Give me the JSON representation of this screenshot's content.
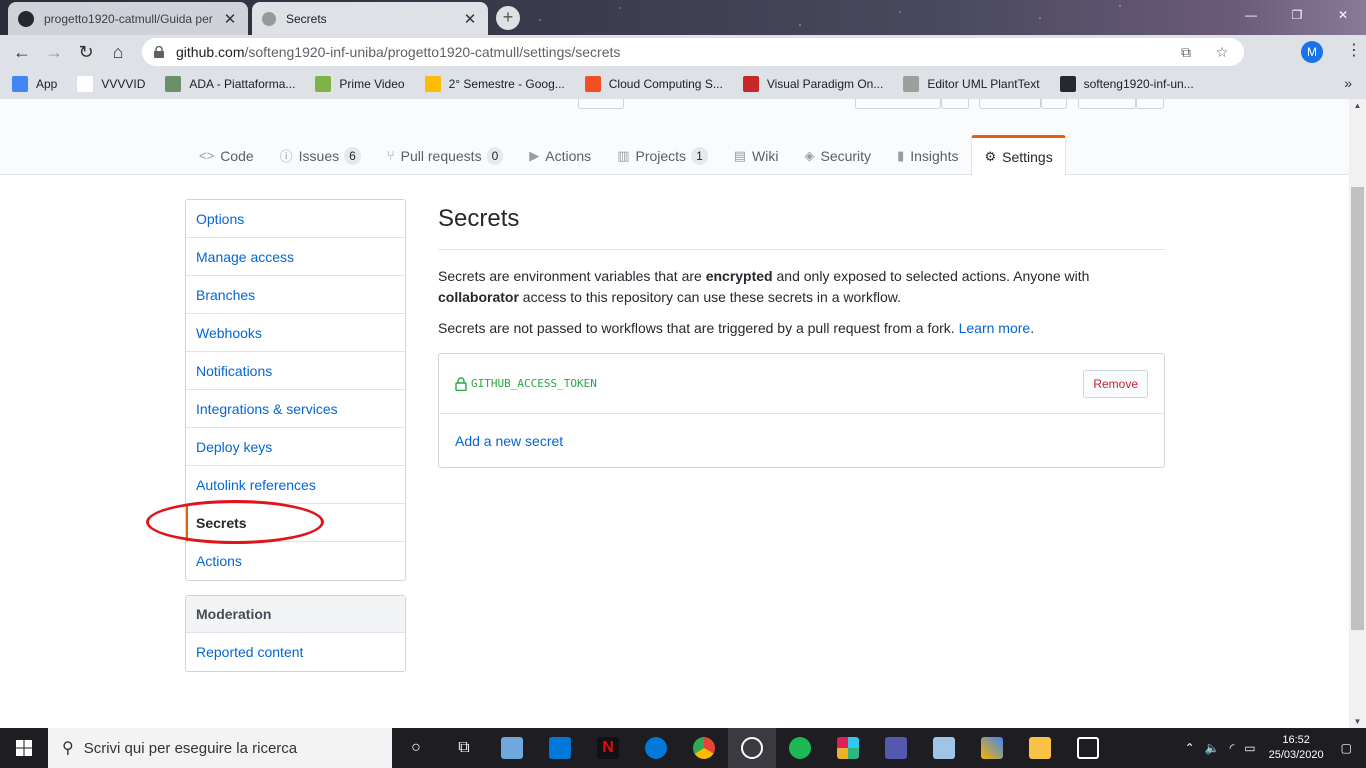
{
  "browser": {
    "tabs": [
      {
        "title": "progetto1920-catmull/Guida per",
        "active": false
      },
      {
        "title": "Secrets",
        "active": true
      }
    ],
    "url_host": "github.com",
    "url_path": "/softeng1920-inf-uniba/progetto1920-catmull/settings/secrets",
    "profile_initial": "M",
    "bookmarks": [
      {
        "label": "App",
        "icon": "apps-grid-icon",
        "color": "#4285f4"
      },
      {
        "label": "VVVVID",
        "icon": "vvvvid-icon",
        "color": "#ffffff"
      },
      {
        "label": "ADA - Piattaforma...",
        "icon": "ada-icon",
        "color": "#6b8e6b"
      },
      {
        "label": "Prime Video",
        "icon": "prime-video-icon",
        "color": "#7cb342"
      },
      {
        "label": "2° Semestre - Goog...",
        "icon": "google-drive-icon",
        "color": "#fbbc04"
      },
      {
        "label": "Cloud Computing S...",
        "icon": "microsoft-icon",
        "color": "#f25022"
      },
      {
        "label": "Visual Paradigm On...",
        "icon": "visual-paradigm-icon",
        "color": "#c62828"
      },
      {
        "label": "Editor UML PlantText",
        "icon": "planttext-icon",
        "color": "#9e9e9e"
      },
      {
        "label": "softeng1920-inf-un...",
        "icon": "github-icon",
        "color": "#24292e"
      }
    ]
  },
  "repo_nav": [
    {
      "label": "Code",
      "icon": "code-icon",
      "glyph": "<>",
      "counter": "",
      "selected": false
    },
    {
      "label": "Issues",
      "icon": "issue-icon",
      "glyph": "ⓘ",
      "counter": "6",
      "selected": false
    },
    {
      "label": "Pull requests",
      "icon": "pull-request-icon",
      "glyph": "⑂",
      "counter": "0",
      "selected": false
    },
    {
      "label": "Actions",
      "icon": "play-icon",
      "glyph": "▶",
      "counter": "",
      "selected": false
    },
    {
      "label": "Projects",
      "icon": "project-icon",
      "glyph": "▥",
      "counter": "1",
      "selected": false
    },
    {
      "label": "Wiki",
      "icon": "book-icon",
      "glyph": "▤",
      "counter": "",
      "selected": false
    },
    {
      "label": "Security",
      "icon": "shield-icon",
      "glyph": "◈",
      "counter": "",
      "selected": false
    },
    {
      "label": "Insights",
      "icon": "graph-icon",
      "glyph": "▮",
      "counter": "",
      "selected": false
    },
    {
      "label": "Settings",
      "icon": "gear-icon",
      "glyph": "⚙",
      "counter": "",
      "selected": true
    }
  ],
  "sidebar": {
    "items": [
      {
        "label": "Options",
        "selected": false
      },
      {
        "label": "Manage access",
        "selected": false
      },
      {
        "label": "Branches",
        "selected": false
      },
      {
        "label": "Webhooks",
        "selected": false
      },
      {
        "label": "Notifications",
        "selected": false
      },
      {
        "label": "Integrations & services",
        "selected": false
      },
      {
        "label": "Deploy keys",
        "selected": false
      },
      {
        "label": "Autolink references",
        "selected": false
      },
      {
        "label": "Secrets",
        "selected": true
      },
      {
        "label": "Actions",
        "selected": false
      }
    ],
    "moderation": {
      "heading": "Moderation",
      "items": [
        {
          "label": "Reported content"
        }
      ]
    }
  },
  "main": {
    "title": "Secrets",
    "p1_a": "Secrets are environment variables that are ",
    "p1_b": "encrypted",
    "p1_c": " and only exposed to selected actions. Anyone with ",
    "p1_d": "collaborator",
    "p1_e": " access to this repository can use these secrets in a workflow.",
    "p2_a": "Secrets are not passed to workflows that are triggered by a pull request from a fork. ",
    "p2_link": "Learn more",
    "p2_end": ".",
    "secret_name": "GITHUB_ACCESS_TOKEN",
    "remove_label": "Remove",
    "add_secret_label": "Add a new secret"
  },
  "taskbar": {
    "search_placeholder": "Scrivi qui per eseguire la ricerca",
    "time": "16:52",
    "date": "25/03/2020"
  },
  "colors": {
    "accent_orange": "#e36209",
    "link_blue": "#0366d6",
    "secret_green": "#28a745",
    "danger_red": "#cb2431",
    "annotation_red": "#e0151b"
  }
}
